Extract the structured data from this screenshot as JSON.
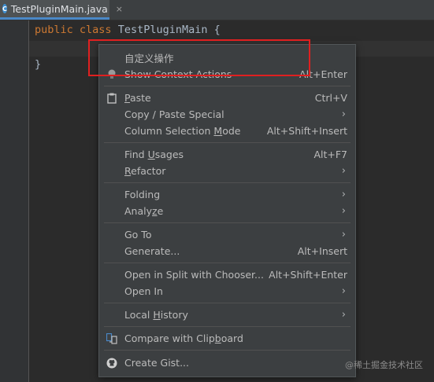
{
  "editor": {
    "tab_label": "TestPluginMain.java",
    "tab_icon_letter": "C",
    "close_glyph": "×",
    "code_public": "public",
    "code_class": "class",
    "code_name": " TestPluginMain {",
    "code_close": "}"
  },
  "menu": {
    "custom_action": "自定义操作",
    "show_context_actions": "Show Context Actions",
    "show_context_actions_sc": "Alt+Enter",
    "paste_pre": "",
    "paste_u": "P",
    "paste_post": "aste",
    "paste_sc": "Ctrl+V",
    "copy_paste_special": "Copy / Paste Special",
    "column_pre": "Column Selection ",
    "column_u": "M",
    "column_post": "ode",
    "column_sc": "Alt+Shift+Insert",
    "find_pre": "Find ",
    "find_u": "U",
    "find_post": "sages",
    "find_sc": "Alt+F7",
    "refactor_u": "R",
    "refactor_post": "efactor",
    "folding": "Folding",
    "analyze_pre": "Analy",
    "analyze_u": "z",
    "analyze_post": "e",
    "goto": "Go To",
    "generate": "Generate...",
    "generate_sc": "Alt+Insert",
    "open_split": "Open in Split with Chooser...",
    "open_split_sc": "Alt+Shift+Enter",
    "open_in": "Open In",
    "local_pre": "Local ",
    "local_u": "H",
    "local_post": "istory",
    "compare_pre": "Compare with Clip",
    "compare_u": "b",
    "compare_post": "oard",
    "create_gist": "Create Gist...",
    "submenu_arrow": "›"
  },
  "watermark": "@稀土掘金技术社区",
  "colors": {
    "accent": "#4a88c7",
    "highlight_box": "#e02020",
    "menu_bg": "#3c3f41",
    "editor_bg": "#2b2b2b",
    "keyword": "#cc7832"
  }
}
